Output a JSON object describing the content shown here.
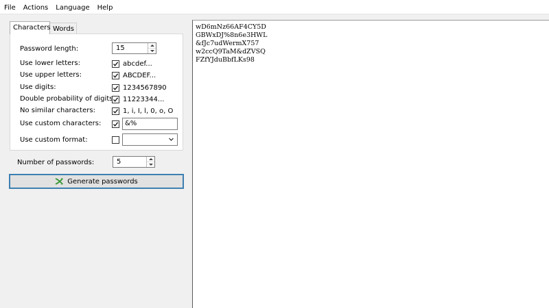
{
  "menu": {
    "file": "File",
    "actions": "Actions",
    "language": "Language",
    "help": "Help"
  },
  "tabs": {
    "characters": "Characters",
    "words": "Words"
  },
  "settings": {
    "password_length_label": "Password length:",
    "password_length_value": "15",
    "lower_label": "Use lower letters:",
    "lower_checked": true,
    "lower_sample": "abcdef...",
    "upper_label": "Use upper letters:",
    "upper_checked": true,
    "upper_sample": "ABCDEF...",
    "digits_label": "Use digits:",
    "digits_checked": true,
    "digits_sample": "1234567890",
    "double_digits_label": "Double probability of digits:",
    "double_digits_checked": true,
    "double_digits_sample": "11223344...",
    "similar_label": "No similar characters:",
    "similar_checked": true,
    "similar_sample": "1, i, I, l, 0, o, O",
    "custom_chars_label": "Use custom characters:",
    "custom_chars_checked": true,
    "custom_chars_value": "&%",
    "custom_format_label": "Use custom format:",
    "custom_format_checked": false,
    "custom_format_value": ""
  },
  "count": {
    "label": "Number of passwords:",
    "value": "5"
  },
  "generate_button": "Generate passwords",
  "passwords": [
    "wD6mNz66AF4CY5D",
    "GBWxDJ%8n6e3HWL",
    "&fJc7udWermX757",
    "w2ccQ9TaM&dZVSQ",
    "FZfYJduBbfLKs98"
  ]
}
